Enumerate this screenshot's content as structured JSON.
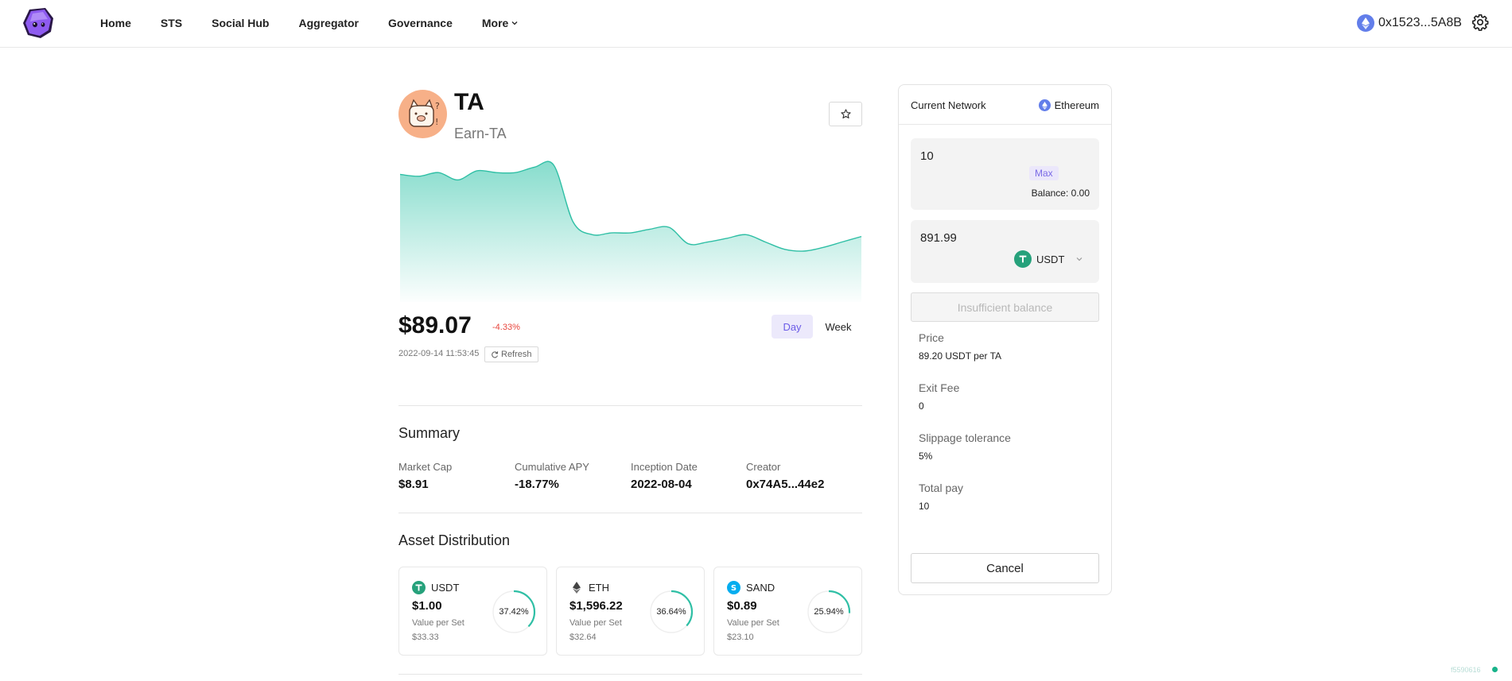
{
  "nav": {
    "items": [
      {
        "label": "Home"
      },
      {
        "label": "STS"
      },
      {
        "label": "Social Hub"
      },
      {
        "label": "Aggregator"
      },
      {
        "label": "Governance"
      },
      {
        "label": "More"
      }
    ],
    "wallet_address": "0x1523...5A8B"
  },
  "token": {
    "symbol": "TA",
    "name": "Earn-TA",
    "price": "$89.07",
    "change": "-4.33%",
    "timestamp": "2022-09-14 11:53:45",
    "refresh_label": "Refresh",
    "ranges": {
      "day": "Day",
      "week": "Week"
    },
    "selected_range": "Day"
  },
  "price_series": [
    96,
    95,
    97,
    93,
    98,
    97,
    97,
    100,
    101,
    70,
    63,
    64,
    64,
    66,
    67,
    58,
    59,
    61,
    63,
    59,
    55,
    54,
    56,
    59,
    62
  ],
  "colors": {
    "accent": "#6c5ce7",
    "chart_line": "#2fbfa5",
    "negative": "#e8453c",
    "usdt": "#26a17b",
    "eth": "#627eea",
    "sand": "#04adef"
  },
  "summary": {
    "title": "Summary",
    "stats": [
      {
        "label": "Market Cap",
        "value": "$8.91"
      },
      {
        "label": "Cumulative APY",
        "value": "-18.77%"
      },
      {
        "label": "Inception Date",
        "value": "2022-08-04"
      },
      {
        "label": "Creator",
        "value": "0x74A5...44e2"
      }
    ]
  },
  "assets": {
    "title": "Asset Distribution",
    "items": [
      {
        "symbol": "USDT",
        "price": "$1.00",
        "value_label": "Value per Set",
        "value": "$33.33",
        "percent_label": "37.42%",
        "percent": 37.42,
        "icon": "tether-icon"
      },
      {
        "symbol": "ETH",
        "price": "$1,596.22",
        "value_label": "Value per Set",
        "value": "$32.64",
        "percent_label": "36.64%",
        "percent": 36.64,
        "icon": "ethereum-icon"
      },
      {
        "symbol": "SAND",
        "price": "$0.89",
        "value_label": "Value per Set",
        "value": "$23.10",
        "percent_label": "25.94%",
        "percent": 25.94,
        "icon": "sand-icon"
      }
    ]
  },
  "trade": {
    "network_label": "Current Network",
    "network": "Ethereum",
    "amount": "10",
    "max_label": "Max",
    "balance": "Balance: 0.00",
    "pay_amount": "891.99",
    "pay_token": "USDT",
    "submit_label": "Insufficient balance",
    "price_label": "Price",
    "price_value": "89.20 USDT per TA",
    "exit_fee_label": "Exit Fee",
    "exit_fee_value": "0",
    "slippage_label": "Slippage tolerance",
    "slippage_value": "5%",
    "total_label": "Total pay",
    "total_value": "10",
    "cancel_label": "Cancel"
  },
  "footer": {
    "version": "f5590616"
  }
}
